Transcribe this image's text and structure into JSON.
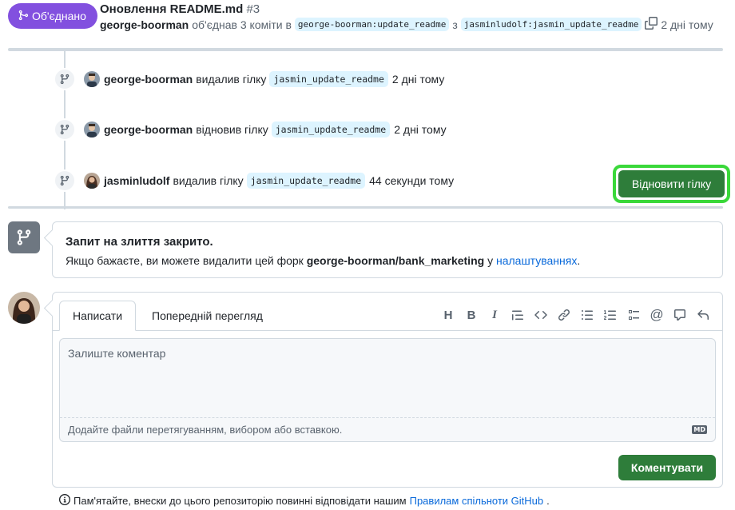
{
  "header": {
    "status_label": "Об'єднано",
    "title": "Оновлення README.md",
    "number": "#3",
    "author": "george-boorman",
    "merge_text": "об'єднав 3 коміти в",
    "base_branch": "george-boorman:update_readme",
    "from_text": "з",
    "head_branch": "jasminludolf:jasmin_update_readme",
    "time": "2 дні тому"
  },
  "timeline": [
    {
      "author": "george-boorman",
      "action": "видалив гілку",
      "branch": "jasmin_update_readme",
      "time": "2 дні тому"
    },
    {
      "author": "george-boorman",
      "action": "відновив гілку",
      "branch": "jasmin_update_readme",
      "time": "2 дні тому"
    },
    {
      "author": "jasminludolf",
      "action": "видалив гілку",
      "branch": "jasmin_update_readme",
      "time": "44 секунди тому"
    }
  ],
  "restore_button": "Відновити гілку",
  "closed": {
    "title": "Запит на злиття закрито.",
    "desc_prefix": "Якщо бажаєте, ви можете видалити цей форк",
    "repo": "george-boorman/bank_marketing",
    "desc_mid": "у",
    "settings_link": "налаштуваннях",
    "desc_suffix": "."
  },
  "comment": {
    "tab_write": "Написати",
    "tab_preview": "Попередній перегляд",
    "placeholder": "Залиште коментар",
    "attach_text": "Додайте файли перетягуванням, вибором або вставкою.",
    "markdown_badge": "MD",
    "submit_label": "Коментувати",
    "toolbar": [
      "heading-icon",
      "bold-icon",
      "italic-icon",
      "quote-icon",
      "code-icon",
      "link-icon",
      "bulleted-list-icon",
      "numbered-list-icon",
      "task-list-icon",
      "mention-icon",
      "cross-reference-icon",
      "reply-icon"
    ]
  },
  "footer": {
    "prefix": "Пам'ятайте, внески до цього репозиторію повинні відповідати нашим",
    "link": "Правилам спільноти GitHub",
    "suffix": "."
  },
  "colors": {
    "merged": "#8250df",
    "primary_button": "#2e7d3a",
    "highlight_outline": "#3ad83a",
    "link": "#0969da"
  }
}
